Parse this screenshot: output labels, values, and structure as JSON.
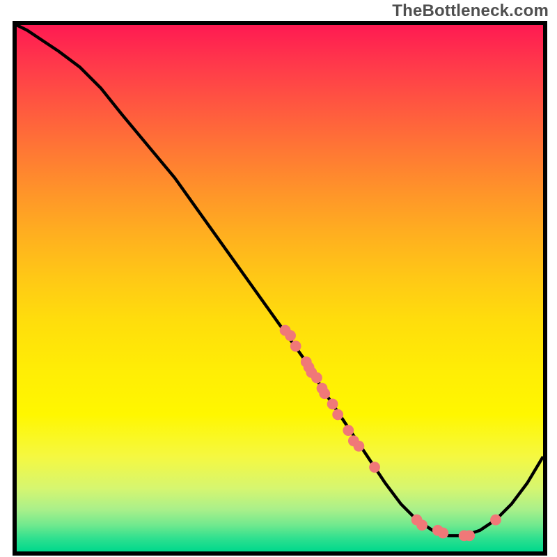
{
  "attribution": "TheBottleneck.com",
  "chart_data": {
    "type": "line",
    "title": "",
    "xlabel": "",
    "ylabel": "",
    "xlim": [
      0,
      100
    ],
    "ylim": [
      0,
      100
    ],
    "curve": {
      "x": [
        0,
        2,
        5,
        8,
        12,
        16,
        20,
        25,
        30,
        35,
        40,
        45,
        50,
        55,
        58,
        62,
        66,
        70,
        73,
        76,
        79,
        82,
        85,
        88,
        91,
        94,
        97,
        100
      ],
      "y": [
        100,
        99,
        97,
        95,
        92,
        88,
        83,
        77,
        71,
        64,
        57,
        50,
        43,
        36,
        31,
        25,
        19,
        13,
        9,
        6,
        4,
        3,
        3,
        4,
        6,
        9,
        13,
        18
      ]
    },
    "points": [
      {
        "x": 51,
        "y": 42
      },
      {
        "x": 52,
        "y": 41
      },
      {
        "x": 53,
        "y": 39
      },
      {
        "x": 55,
        "y": 36
      },
      {
        "x": 55.5,
        "y": 35
      },
      {
        "x": 56,
        "y": 34
      },
      {
        "x": 57,
        "y": 33
      },
      {
        "x": 58,
        "y": 31
      },
      {
        "x": 58.5,
        "y": 30
      },
      {
        "x": 60,
        "y": 28
      },
      {
        "x": 61,
        "y": 26
      },
      {
        "x": 63,
        "y": 23
      },
      {
        "x": 64,
        "y": 21
      },
      {
        "x": 65,
        "y": 20
      },
      {
        "x": 68,
        "y": 16
      },
      {
        "x": 76,
        "y": 6
      },
      {
        "x": 77,
        "y": 5
      },
      {
        "x": 80,
        "y": 4
      },
      {
        "x": 81,
        "y": 3.5
      },
      {
        "x": 85,
        "y": 3
      },
      {
        "x": 86,
        "y": 3
      },
      {
        "x": 91,
        "y": 6
      }
    ],
    "point_color": "#f07878",
    "point_radius": 8,
    "line_color": "#000000",
    "line_width": 3.5
  }
}
